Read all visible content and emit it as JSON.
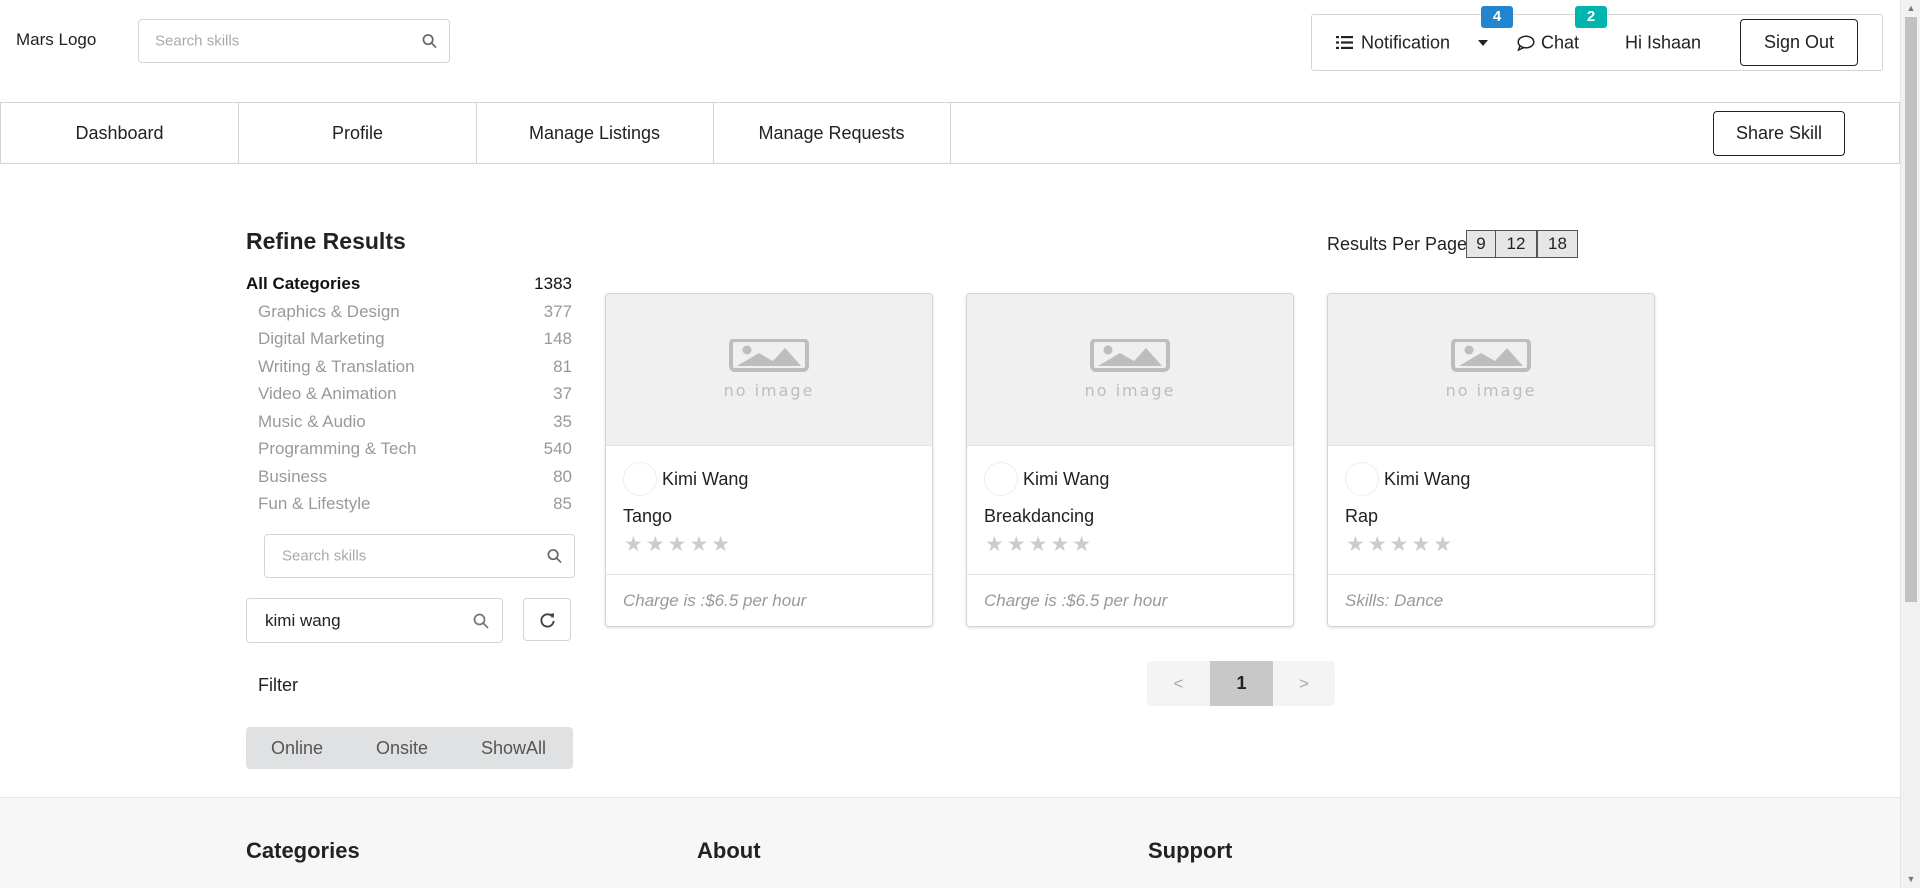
{
  "header": {
    "logo": "Mars Logo",
    "search_placeholder": "Search skills",
    "notification_label": "Notification",
    "notification_count": "4",
    "chat_label": "Chat",
    "chat_count": "2",
    "greeting": "Hi Ishaan",
    "signout_label": "Sign Out",
    "colors": {
      "notification_badge": "#2185d0",
      "chat_badge": "#00b5ad"
    }
  },
  "nav": {
    "items": [
      {
        "label": "Dashboard"
      },
      {
        "label": "Profile"
      },
      {
        "label": "Manage Listings"
      },
      {
        "label": "Manage Requests"
      }
    ],
    "share_label": "Share Skill"
  },
  "sidebar": {
    "title": "Refine Results",
    "categories": [
      {
        "name": "All Categories",
        "count": "1383"
      },
      {
        "name": "Graphics & Design",
        "count": "377"
      },
      {
        "name": "Digital Marketing",
        "count": "148"
      },
      {
        "name": "Writing & Translation",
        "count": "81"
      },
      {
        "name": "Video & Animation",
        "count": "37"
      },
      {
        "name": "Music & Audio",
        "count": "35"
      },
      {
        "name": "Programming & Tech",
        "count": "540"
      },
      {
        "name": "Business",
        "count": "80"
      },
      {
        "name": "Fun & Lifestyle",
        "count": "85"
      }
    ],
    "skill_search_placeholder": "Search skills",
    "name_search_value": "kimi wang",
    "filter_label": "Filter",
    "filters": [
      "Online",
      "Onsite",
      "ShowAll"
    ]
  },
  "results": {
    "per_page_label": "Results Per Page :",
    "per_page_options": [
      "9",
      "12",
      "18"
    ],
    "cards": [
      {
        "image_text": "no image",
        "seller": "Kimi Wang",
        "title": "Tango",
        "rating": 0,
        "footer": "Charge is :$6.5 per hour"
      },
      {
        "image_text": "no image",
        "seller": "Kimi Wang",
        "title": "Breakdancing",
        "rating": 0,
        "footer": "Charge is :$6.5 per hour"
      },
      {
        "image_text": "no image",
        "seller": "Kimi Wang",
        "title": "Rap",
        "rating": 0,
        "footer": "Skills: Dance"
      }
    ],
    "pagination": {
      "prev": "<",
      "current": "1",
      "next": ">"
    }
  },
  "footer": {
    "headings": [
      "Categories",
      "About",
      "Support"
    ]
  }
}
